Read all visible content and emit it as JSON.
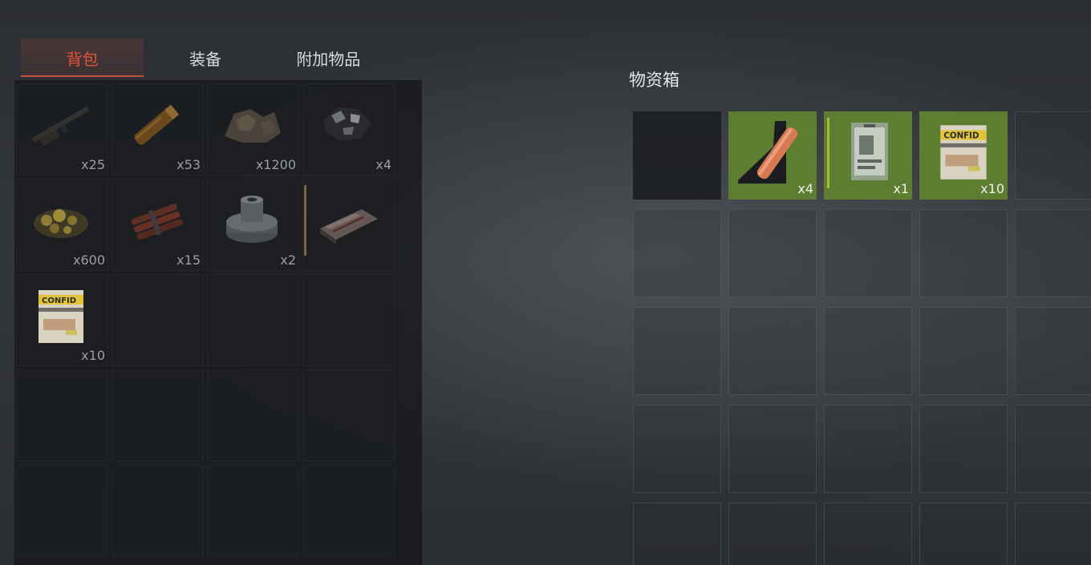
{
  "tabs": [
    {
      "label": "背包",
      "active": true
    },
    {
      "label": "装备",
      "active": false
    },
    {
      "label": "附加物品",
      "active": false
    }
  ],
  "backpack": {
    "cells": [
      {
        "icon": "rifle-icon",
        "count": "x25"
      },
      {
        "icon": "cartridge-icon",
        "count": "x53"
      },
      {
        "icon": "ore-icon",
        "count": "x1200"
      },
      {
        "icon": "coal-icon",
        "count": "x4"
      },
      {
        "icon": "gold-nuggets-icon",
        "count": "x600"
      },
      {
        "icon": "dynamite-icon",
        "count": "x15"
      },
      {
        "icon": "gear-icon",
        "count": "x2"
      },
      {
        "icon": "bed-icon",
        "count": ""
      },
      {
        "icon": "confidential-document-icon",
        "count": "x10"
      },
      {
        "icon": "",
        "count": ""
      },
      {
        "icon": "",
        "count": ""
      },
      {
        "icon": "",
        "count": ""
      },
      {
        "icon": "",
        "count": ""
      },
      {
        "icon": "",
        "count": ""
      },
      {
        "icon": "",
        "count": ""
      },
      {
        "icon": "",
        "count": ""
      },
      {
        "icon": "",
        "count": ""
      },
      {
        "icon": "",
        "count": ""
      },
      {
        "icon": "",
        "count": ""
      },
      {
        "icon": "",
        "count": ""
      }
    ]
  },
  "chest": {
    "title": "物资箱",
    "cells": [
      {
        "icon": "",
        "count": "",
        "state": "dark"
      },
      {
        "icon": "bandage-icon",
        "count": "x4",
        "state": "filled"
      },
      {
        "icon": "id-card-icon",
        "count": "x1",
        "state": "filled"
      },
      {
        "icon": "confidential-document-icon",
        "count": "x10",
        "state": "filled"
      },
      {
        "icon": "",
        "count": "",
        "state": "empty"
      },
      {
        "icon": "",
        "count": "",
        "state": "empty"
      },
      {
        "icon": "",
        "count": "",
        "state": "empty"
      },
      {
        "icon": "",
        "count": "",
        "state": "empty"
      },
      {
        "icon": "",
        "count": "",
        "state": "empty"
      },
      {
        "icon": "",
        "count": "",
        "state": "empty"
      },
      {
        "icon": "",
        "count": "",
        "state": "empty"
      },
      {
        "icon": "",
        "count": "",
        "state": "empty"
      },
      {
        "icon": "",
        "count": "",
        "state": "empty"
      },
      {
        "icon": "",
        "count": "",
        "state": "empty"
      },
      {
        "icon": "",
        "count": "",
        "state": "empty"
      },
      {
        "icon": "",
        "count": "",
        "state": "empty"
      },
      {
        "icon": "",
        "count": "",
        "state": "empty"
      },
      {
        "icon": "",
        "count": "",
        "state": "empty"
      },
      {
        "icon": "",
        "count": "",
        "state": "empty"
      },
      {
        "icon": "",
        "count": "",
        "state": "empty"
      },
      {
        "icon": "",
        "count": "",
        "state": "empty"
      },
      {
        "icon": "",
        "count": "",
        "state": "empty"
      },
      {
        "icon": "",
        "count": "",
        "state": "empty"
      },
      {
        "icon": "",
        "count": "",
        "state": "empty"
      },
      {
        "icon": "",
        "count": "",
        "state": "empty"
      }
    ]
  },
  "colors": {
    "active_tab": "#e8503a",
    "filled_slot": "#5d7d31"
  },
  "confidential_label": "CONFID"
}
